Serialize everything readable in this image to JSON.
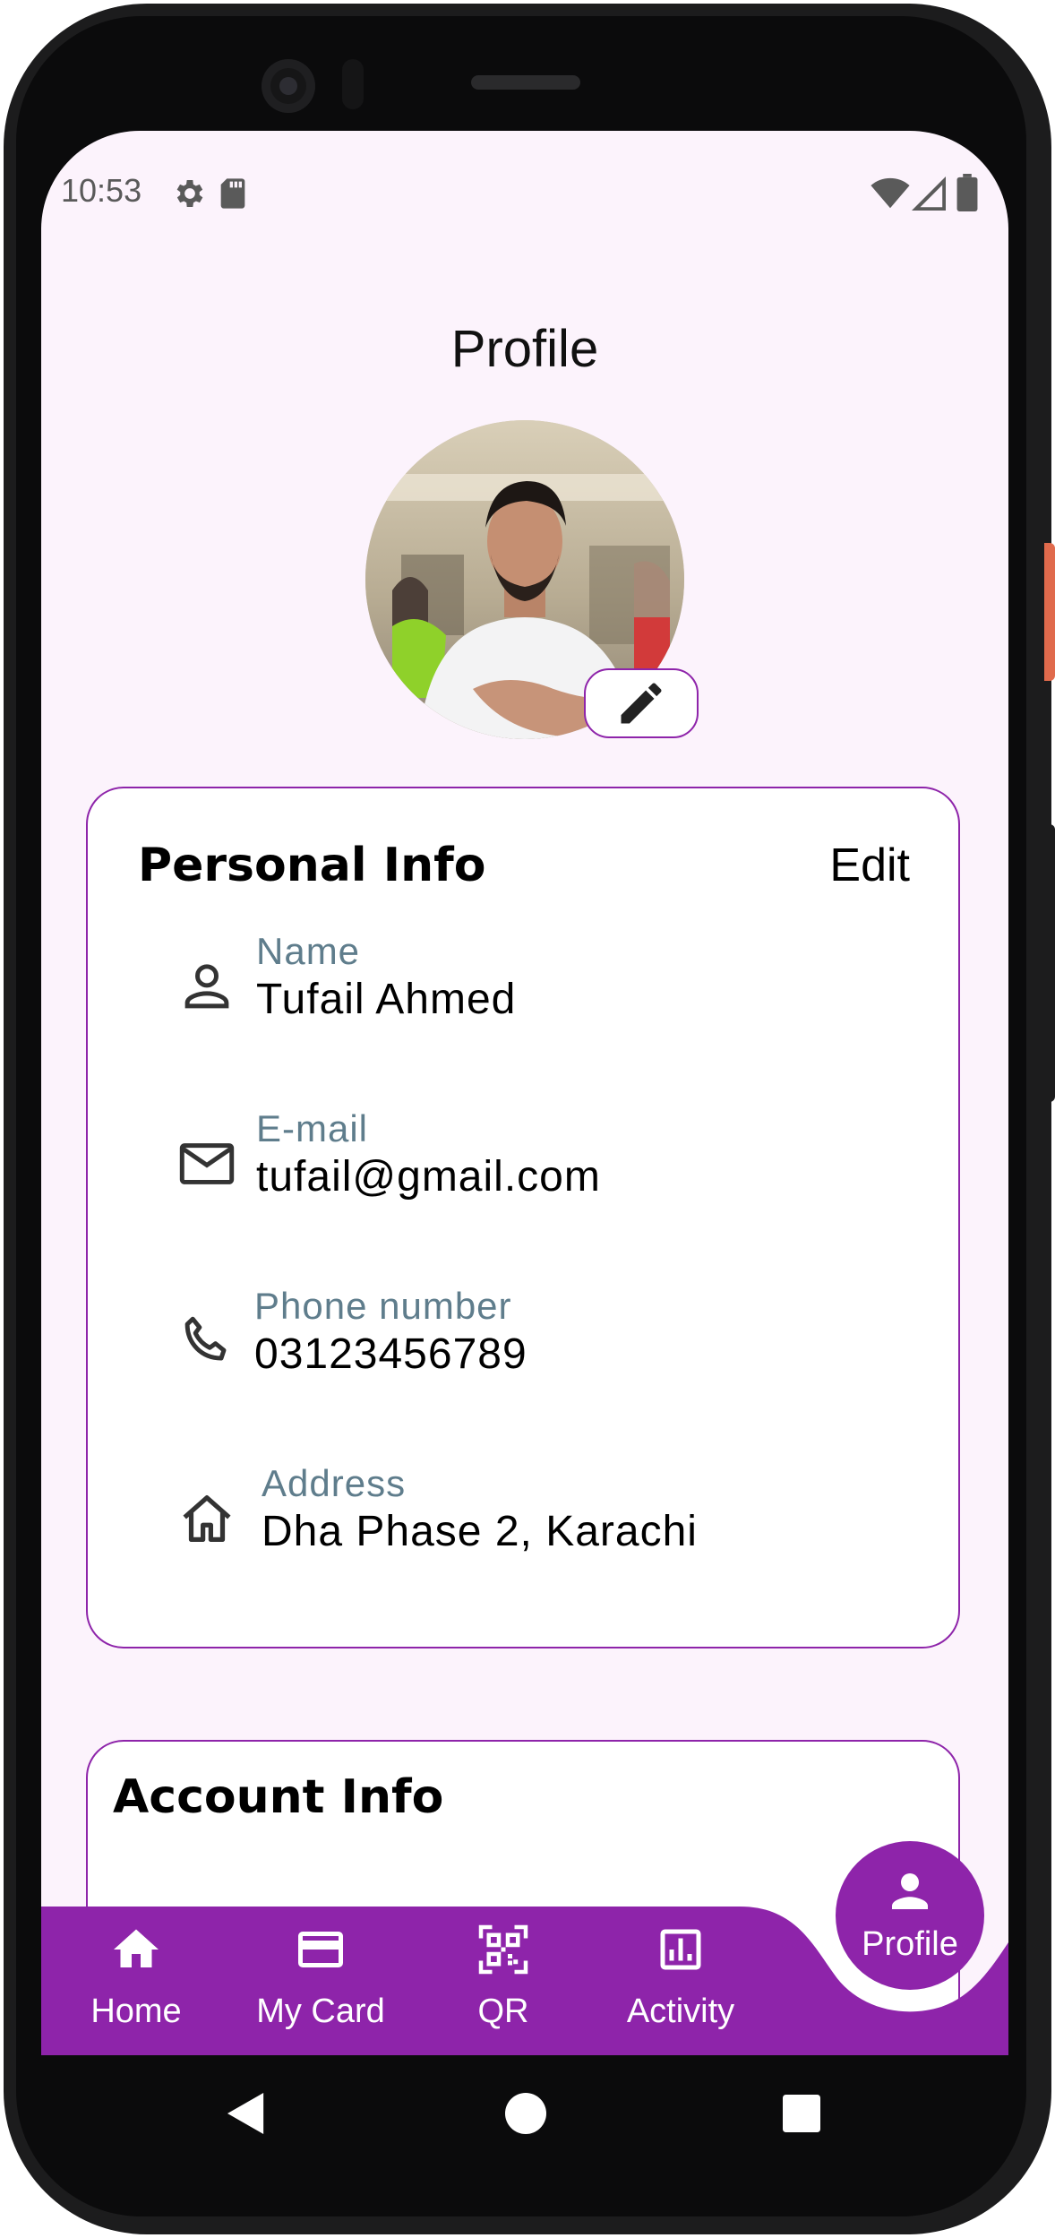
{
  "status_bar": {
    "time": "10:53"
  },
  "page": {
    "title": "Profile"
  },
  "personal_info": {
    "title": "Personal Info",
    "edit_label": "Edit",
    "fields": [
      {
        "label": "Name",
        "value": "Tufail Ahmed",
        "icon": "person-outline-icon"
      },
      {
        "label": "E-mail",
        "value": "tufail@gmail.com",
        "icon": "mail-outline-icon"
      },
      {
        "label": "Phone number",
        "value": "03123456789",
        "icon": "phone-icon"
      },
      {
        "label": "Address",
        "value": "Dha Phase 2, Karachi",
        "icon": "home-outline-icon"
      }
    ]
  },
  "account_info": {
    "title": "Account Info"
  },
  "bottom_nav": {
    "items": [
      {
        "label": "Home",
        "icon": "home-icon"
      },
      {
        "label": "My Card",
        "icon": "credit-card-icon"
      },
      {
        "label": "QR",
        "icon": "qr-code-icon"
      },
      {
        "label": "Activity",
        "icon": "activity-chart-icon"
      },
      {
        "label": "Profile",
        "icon": "person-icon",
        "selected": true
      }
    ]
  },
  "colors": {
    "accent": "#8e24aa",
    "screen_background": "#fcf3fc",
    "label_text": "#5f7d8c"
  }
}
